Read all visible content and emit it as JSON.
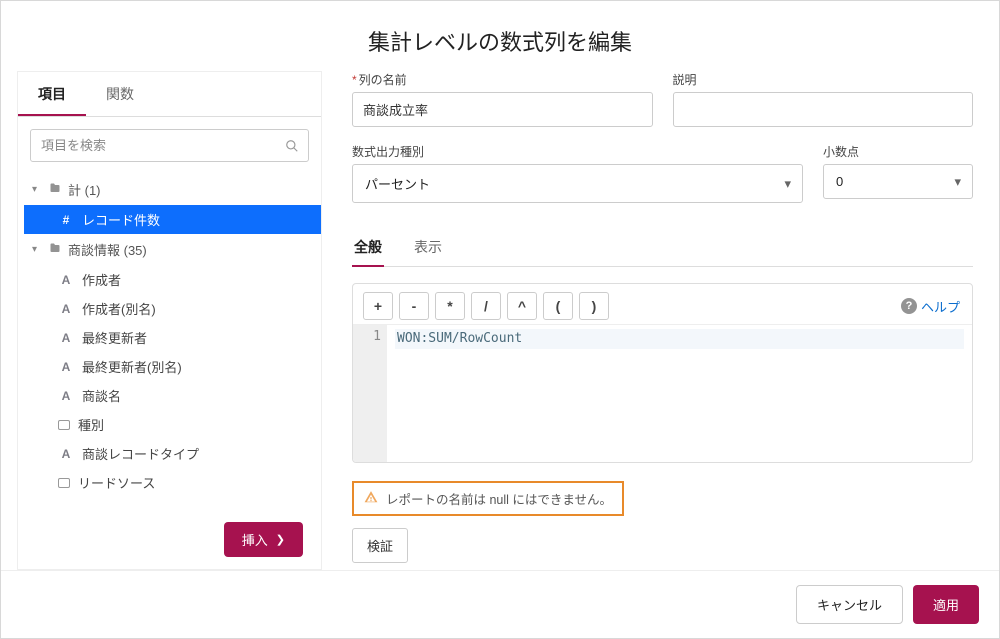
{
  "dialog": {
    "title": "集計レベルの数式列を編集"
  },
  "left": {
    "tabs": [
      {
        "label": "項目",
        "active": true
      },
      {
        "label": "関数",
        "active": false
      }
    ],
    "search_placeholder": "項目を検索",
    "groups": [
      {
        "label": "計 (1)",
        "items": [
          {
            "type": "#",
            "label": "レコード件数",
            "active": true
          }
        ]
      },
      {
        "label": "商談情報 (35)",
        "items": [
          {
            "type": "A",
            "label": "作成者"
          },
          {
            "type": "A",
            "label": "作成者(別名)"
          },
          {
            "type": "A",
            "label": "最終更新者"
          },
          {
            "type": "A",
            "label": "最終更新者(別名)"
          },
          {
            "type": "A",
            "label": "商談名"
          },
          {
            "type": "box",
            "label": "種別"
          },
          {
            "type": "A",
            "label": "商談レコードタイプ"
          },
          {
            "type": "box",
            "label": "リードソース"
          }
        ]
      }
    ],
    "insert_label": "挿入"
  },
  "form": {
    "name_label": "列の名前",
    "name_value": "商談成立率",
    "desc_label": "説明",
    "desc_value": "",
    "output_label": "数式出力種別",
    "output_value": "パーセント",
    "decimal_label": "小数点",
    "decimal_value": "0",
    "sub_tabs": [
      {
        "label": "全般",
        "active": true
      },
      {
        "label": "表示",
        "active": false
      }
    ]
  },
  "editor": {
    "ops": [
      "+",
      "-",
      "*",
      "/",
      "^",
      "(",
      ")"
    ],
    "help_label": "ヘルプ",
    "line_no": "1",
    "code": "WON:SUM/RowCount"
  },
  "warning": {
    "text": "レポートの名前は null にはできません。"
  },
  "validate_label": "検証",
  "footer": {
    "cancel": "キャンセル",
    "apply": "適用"
  }
}
